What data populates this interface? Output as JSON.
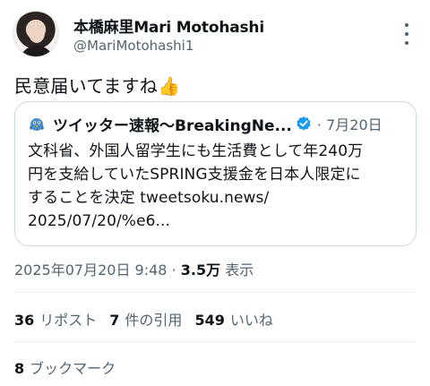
{
  "author": {
    "display_name": "本橋麻里Mari Motohashi",
    "handle": "@MariMotohashi1"
  },
  "tweet": {
    "text": "民意届いてますね👍"
  },
  "quoted": {
    "author": "ツイッター速報〜BreakingNe...",
    "date": "7月20日",
    "lines": [
      "文科省、外国人留学生にも生活費として年240万",
      "円を支給していたSPRING支援金を日本人限定に",
      "することを決定 tweetsoku.news/",
      "2025/07/20/%e6..."
    ]
  },
  "meta": {
    "timestamp": "2025年07月20日 9:48",
    "separator": "·",
    "views": "3.5万",
    "views_label": "表示"
  },
  "stats": {
    "reposts_count": "36",
    "reposts_label": "リポスト",
    "quotes_count": "7",
    "quotes_label": "件の引用",
    "likes_count": "549",
    "likes_label": "いいね"
  },
  "bookmarks": {
    "count": "8",
    "label": "ブックマーク"
  },
  "colors": {
    "text": "#0f1419",
    "secondary": "#536471",
    "border": "#cfd9de",
    "verified": "#1d9bf0"
  },
  "icons": [
    "avatar",
    "more-icon",
    "bird-icon",
    "verified-icon"
  ]
}
